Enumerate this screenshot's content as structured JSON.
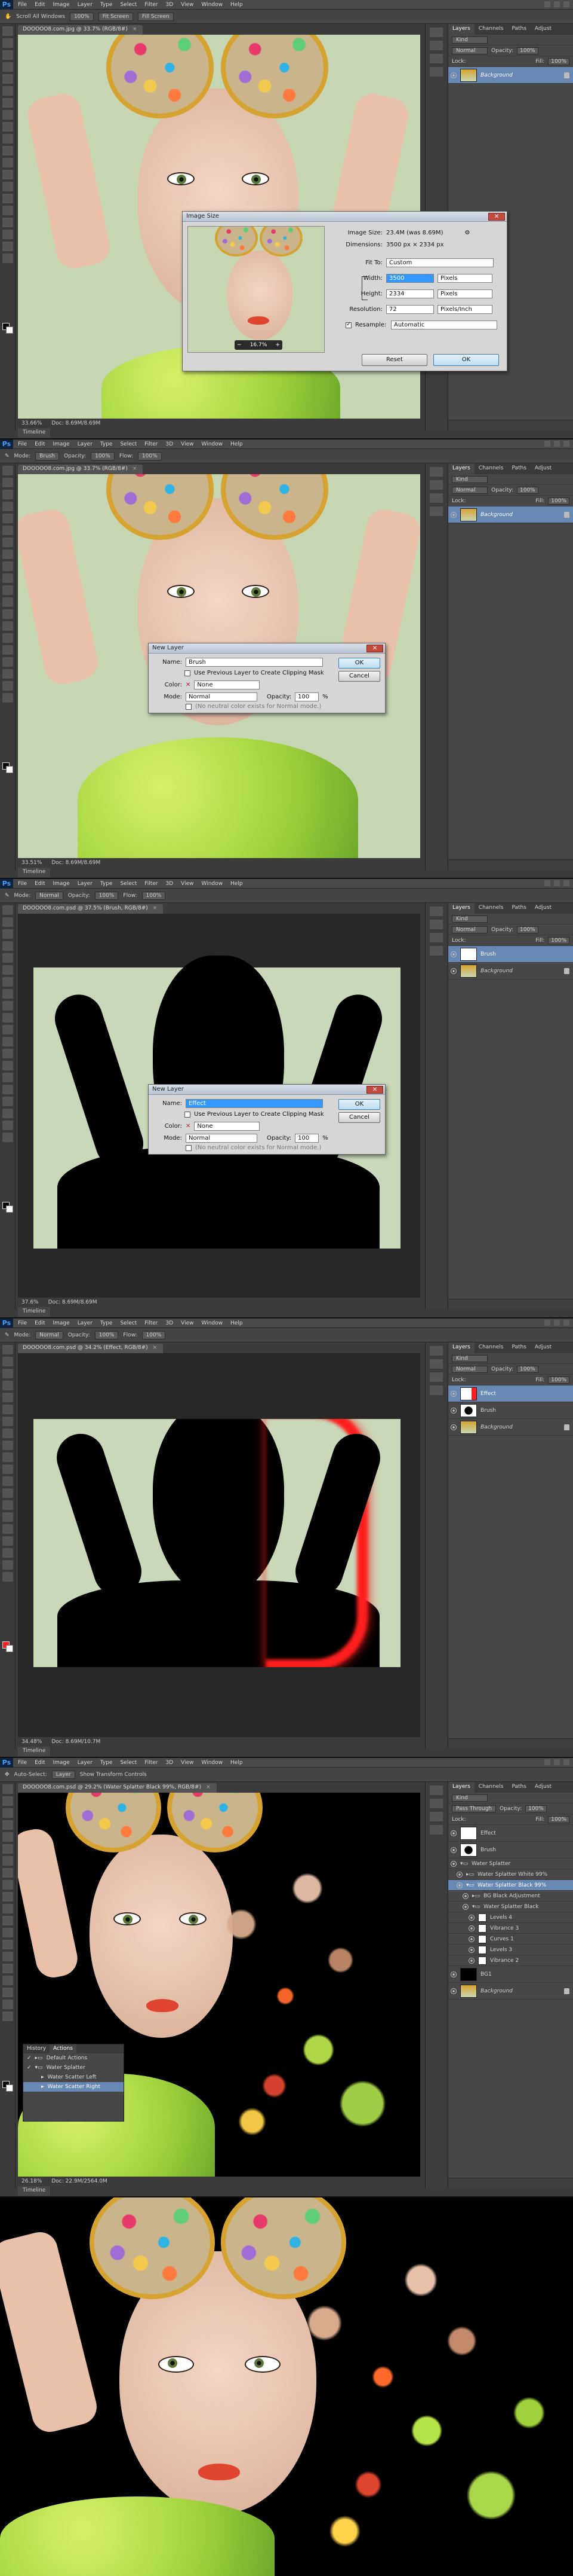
{
  "menu": [
    "File",
    "Edit",
    "Image",
    "Layer",
    "Type",
    "Select",
    "Filter",
    "3D",
    "View",
    "Window",
    "Help"
  ],
  "app_badge": "Ps",
  "panels": [
    {
      "options": [
        "Scroll All Windows",
        "100%",
        "Fit Screen",
        "Fill Screen"
      ],
      "doc_tab": "DOOOOO8.com.jpg @ 33.7% (RGB/8#)",
      "zoom": "33.66%",
      "doc_size": "Doc: 8.69M/8.69M",
      "timeline": "Timeline",
      "layers_tabs": [
        "Layers",
        "Channels",
        "Paths",
        "Adjust"
      ],
      "kind": "Kind",
      "blend": "Normal",
      "opacity_label": "Opacity:",
      "opacity": "100%",
      "fill_label": "Fill:",
      "fill": "100%",
      "lock_label": "Lock:",
      "layers": [
        {
          "name": "Background",
          "italic": true,
          "selected": true
        }
      ]
    },
    {
      "options": [
        "Mode:",
        "Brush",
        "Opacity:",
        "100%",
        "Flow:",
        "100%"
      ],
      "doc_tab": "DOOOOO8.com.jpg @ 33.7% (RGB/8#)",
      "zoom": "33.51%",
      "doc_size": "Doc: 8.69M/8.69M",
      "timeline": "Timeline",
      "layers": [
        {
          "name": "Background",
          "italic": true,
          "selected": true
        }
      ]
    },
    {
      "options": [
        "Mode:",
        "Normal",
        "Opacity:",
        "100%",
        "Flow:",
        "100%"
      ],
      "doc_tab": "DOOOOO8.com.psd @ 37.5% (Brush, RGB/8#)",
      "zoom": "37.6%",
      "doc_size": "Doc: 8.69M/8.69M",
      "timeline": "Timeline",
      "layers": [
        {
          "name": "Brush",
          "italic": false,
          "selected": true
        },
        {
          "name": "Background",
          "italic": true,
          "selected": false
        }
      ]
    },
    {
      "options": [
        "Mode:",
        "Normal",
        "Opacity:",
        "100%",
        "Flow:",
        "100%"
      ],
      "doc_tab": "DOOOOO8.com.psd @ 34.2% (Effect, RGB/8#)",
      "zoom": "34.48%",
      "doc_size": "Doc: 8.69M/10.7M",
      "timeline": "Timeline",
      "layers": [
        {
          "name": "Effect",
          "italic": false,
          "selected": true
        },
        {
          "name": "Brush",
          "italic": false,
          "selected": false
        },
        {
          "name": "Background",
          "italic": true,
          "selected": false
        }
      ]
    },
    {
      "options": [
        "Auto-Select:",
        "Layer",
        "Show Transform Controls"
      ],
      "doc_tab": "DOOOOO8.com.psd @ 29.2% (Water Splatter Black 99%, RGB/8#)",
      "zoom": "26.18%",
      "doc_size": "Doc: 22.9M/2564.0M",
      "timeline": "Timeline",
      "blend": "Pass Through",
      "layers": [
        {
          "name": "Effect",
          "italic": false,
          "selected": false
        },
        {
          "name": "Brush",
          "italic": false,
          "selected": false
        },
        {
          "name": "Water Splatter",
          "italic": false,
          "selected": false
        },
        {
          "name": "Water Splatter White 99%",
          "italic": false,
          "selected": false
        },
        {
          "name": "Water Splatter Black 99%",
          "italic": false,
          "selected": true
        },
        {
          "name": "BG Black Adjustment",
          "italic": false,
          "selected": false
        },
        {
          "name": "Water Splatter Black",
          "italic": false,
          "selected": false
        },
        {
          "name": "Levels 4",
          "italic": false,
          "selected": false
        },
        {
          "name": "Vibrance 3",
          "italic": false,
          "selected": false
        },
        {
          "name": "Curves 1",
          "italic": false,
          "selected": false
        },
        {
          "name": "Levels 3",
          "italic": false,
          "selected": false
        },
        {
          "name": "Vibrance 2",
          "italic": false,
          "selected": false
        },
        {
          "name": "BG1",
          "italic": false,
          "selected": false
        },
        {
          "name": "Background",
          "italic": true,
          "selected": false
        }
      ],
      "actions": {
        "tabs": [
          "History",
          "Actions"
        ],
        "items": [
          "Default Actions",
          "Water Splatter",
          "Water Scatter Left",
          "Water Scatter Right"
        ]
      }
    }
  ],
  "image_size_dialog": {
    "title": "Image Size",
    "image_size_label": "Image Size:",
    "image_size_value": "23.4M (was 8.69M)",
    "dimensions_label": "Dimensions:",
    "dimensions_value": "3500 px × 2334 px",
    "fit_to_label": "Fit To:",
    "fit_to_value": "Custom",
    "width_label": "Width:",
    "width_value": "3500",
    "width_unit": "Pixels",
    "height_label": "Height:",
    "height_value": "2334",
    "height_unit": "Pixels",
    "resolution_label": "Resolution:",
    "resolution_value": "72",
    "resolution_unit": "Pixels/Inch",
    "resample_label": "Resample:",
    "resample_value": "Automatic",
    "preview_zoom": "16.7%",
    "reset": "Reset",
    "ok": "OK"
  },
  "new_layer_dialog_1": {
    "title": "New Layer",
    "name_label": "Name:",
    "name_value": "Brush",
    "use_prev": "Use Previous Layer to Create Clipping Mask",
    "color_label": "Color:",
    "color_value": "None",
    "mode_label": "Mode:",
    "mode_value": "Normal",
    "opacity_label": "Opacity:",
    "opacity_value": "100",
    "percent": "%",
    "hint": "(No neutral color exists for Normal mode.)",
    "ok": "OK",
    "cancel": "Cancel"
  },
  "new_layer_dialog_2": {
    "title": "New Layer",
    "name_label": "Name:",
    "name_value": "Effect",
    "use_prev": "Use Previous Layer to Create Clipping Mask",
    "color_label": "Color:",
    "color_value": "None",
    "mode_label": "Mode:",
    "mode_value": "Normal",
    "opacity_label": "Opacity:",
    "opacity_value": "100",
    "percent": "%",
    "hint": "(No neutral color exists for Normal mode.)",
    "ok": "OK",
    "cancel": "Cancel"
  },
  "colors": {
    "accent_blue": "#6688b3",
    "lens_gold": "#d6a330",
    "bg_green": "#c8d7b4",
    "lips_red": "#e0452f",
    "glow_red": "#ff1e1e",
    "shirt_green": "#a8d84a"
  }
}
